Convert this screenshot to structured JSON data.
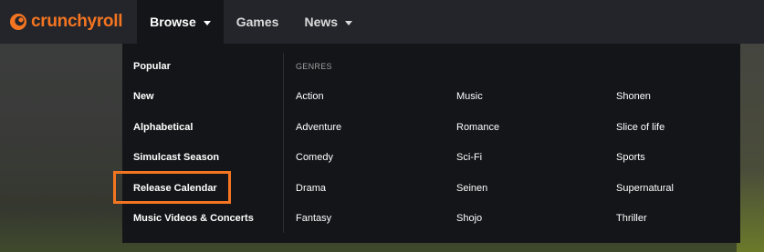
{
  "brand": {
    "name": "crunchyroll",
    "accent": "#f47521"
  },
  "nav": {
    "browse": "Browse",
    "games": "Games",
    "news": "News"
  },
  "browse_menu": {
    "links": [
      "Popular",
      "New",
      "Alphabetical",
      "Simulcast Season",
      "Release Calendar",
      "Music Videos & Concerts"
    ],
    "genres_heading": "GENRES",
    "genres_col1": [
      "Action",
      "Adventure",
      "Comedy",
      "Drama",
      "Fantasy"
    ],
    "genres_col2": [
      "Music",
      "Romance",
      "Sci-Fi",
      "Seinen",
      "Shojo"
    ],
    "genres_col3": [
      "Shonen",
      "Slice of life",
      "Sports",
      "Supernatural",
      "Thriller"
    ]
  },
  "highlighted_item": "Release Calendar"
}
